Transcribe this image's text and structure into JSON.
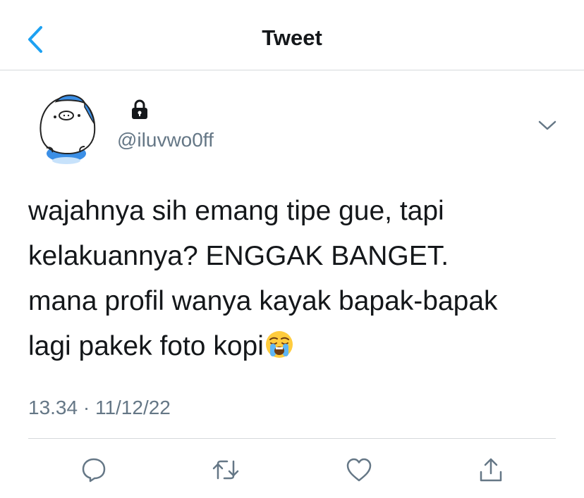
{
  "header": {
    "title": "Tweet",
    "back_icon": "chevron-left-icon",
    "accent_color": "#1da1f2"
  },
  "tweet": {
    "handle": "@iluvwo0ff",
    "protected_icon": "lock-icon",
    "more_icon": "chevron-down-icon",
    "text": "wajahnya sih emang tipe gue, tapi\nkelakuannya? ENGGAK BANGET.\nmana profil wanya kayak bapak-bapak\nlagi pakek foto kopi",
    "emoji": "loudly-crying-face-emoji",
    "timestamp": "13.34 · 11/12/22"
  },
  "actions": {
    "reply_icon": "reply-icon",
    "retweet_icon": "retweet-icon",
    "like_icon": "heart-icon",
    "share_icon": "share-icon"
  }
}
